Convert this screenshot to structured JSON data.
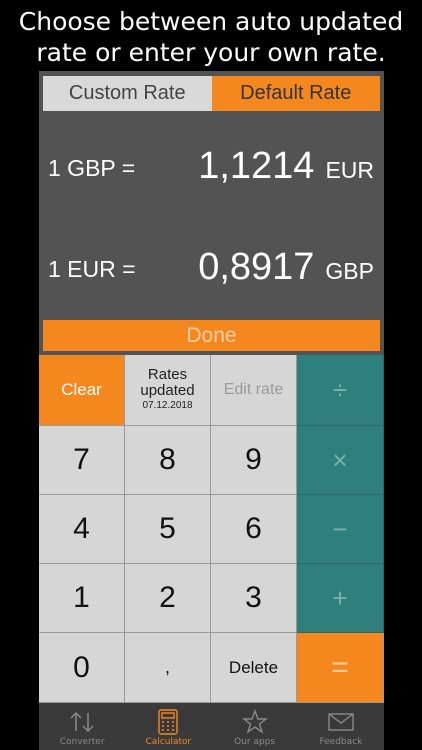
{
  "promo": {
    "line1": "Choose between auto updated",
    "line2": "rate or enter your own rate."
  },
  "segment": {
    "custom": "Custom Rate",
    "default": "Default Rate"
  },
  "rate1": {
    "label": "1 GBP =",
    "value": "1,1214",
    "currency": "EUR"
  },
  "rate2": {
    "label": "1 EUR =",
    "value": "0,8917",
    "currency": "GBP"
  },
  "done_label": "Done",
  "keys": {
    "clear": "Clear",
    "rates_line1": "Rates",
    "rates_line2": "updated",
    "rates_date": "07.12.2018",
    "edit_rate": "Edit rate",
    "divide": "÷",
    "multiply": "×",
    "minus": "−",
    "plus": "+",
    "equals": "=",
    "n7": "7",
    "n8": "8",
    "n9": "9",
    "n4": "4",
    "n5": "5",
    "n6": "6",
    "n1": "1",
    "n2": "2",
    "n3": "3",
    "n0": "0",
    "comma": ",",
    "delete": "Delete"
  },
  "tabs": {
    "converter": "Converter",
    "calculator": "Calculator",
    "our_apps": "Our apps",
    "feedback": "Feedback"
  },
  "colors": {
    "accent": "#f5871f",
    "teal": "#2f7f7c"
  }
}
